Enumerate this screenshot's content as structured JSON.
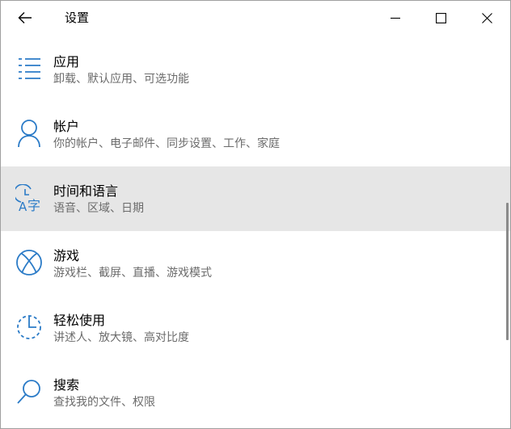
{
  "window": {
    "title": "设置"
  },
  "colors": {
    "accent": "#2b7bc7",
    "hover_bg": "#e6e6e6",
    "desc_text": "#6b6b6b"
  },
  "items": [
    {
      "icon": "list-icon",
      "name": "应用",
      "desc": "卸载、默认应用、可选功能",
      "hovered": false
    },
    {
      "icon": "person-icon",
      "name": "帐户",
      "desc": "你的帐户、电子邮件、同步设置、工作、家庭",
      "hovered": false
    },
    {
      "icon": "time-language-icon",
      "name": "时间和语言",
      "desc": "语音、区域、日期",
      "hovered": true
    },
    {
      "icon": "xbox-icon",
      "name": "游戏",
      "desc": "游戏栏、截屏、直播、游戏模式",
      "hovered": false
    },
    {
      "icon": "ease-of-access-icon",
      "name": "轻松使用",
      "desc": "讲述人、放大镜、高对比度",
      "hovered": false
    },
    {
      "icon": "search-icon",
      "name": "搜索",
      "desc": "查找我的文件、权限",
      "hovered": false
    }
  ]
}
